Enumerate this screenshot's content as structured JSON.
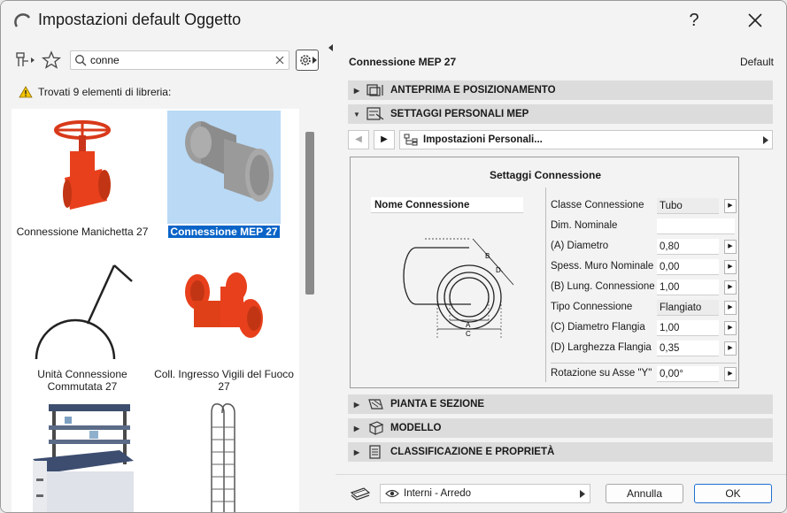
{
  "window": {
    "title": "Impostazioni default Oggetto",
    "help": "?"
  },
  "search": {
    "value": "conne"
  },
  "library": {
    "found_text": "Trovati 9 elementi di libreria:",
    "items": [
      {
        "label": "Connessione Manichetta 27",
        "selected": false
      },
      {
        "label": "Connessione MEP 27",
        "selected": true
      },
      {
        "label": "Unità Connessione Commutata 27",
        "selected": false
      },
      {
        "label": "Coll. Ingresso Vigili del Fuoco 27",
        "selected": false
      },
      {
        "label": "",
        "selected": false
      },
      {
        "label": "",
        "selected": false
      }
    ]
  },
  "header": {
    "object_name": "Connessione MEP 27",
    "default_label": "Default"
  },
  "sections": {
    "preview": "ANTEPRIMA E POSIZIONAMENTO",
    "custom": "SETTAGGI PERSONALI MEP",
    "plan": "PIANTA E SEZIONE",
    "model": "MODELLO",
    "classification": "CLASSIFICAZIONE E PROPRIETÀ"
  },
  "custom_panel": {
    "selector": "Impostazioni Personali...",
    "box_title": "Settaggi Connessione",
    "name_field": "Nome Connessione",
    "params": [
      {
        "label": "Classe Connessione",
        "value": "Tubo"
      },
      {
        "label": "Dim. Nominale",
        "value": ""
      },
      {
        "label": "(A) Diametro",
        "value": "0,80"
      },
      {
        "label": "Spess. Muro Nominale",
        "value": "0,00"
      },
      {
        "label": "(B) Lung. Connessione",
        "value": "1,00"
      },
      {
        "label": "Tipo Connessione",
        "value": "Flangiato"
      },
      {
        "label": "(C) Diametro Flangia",
        "value": "1,00"
      },
      {
        "label": "(D) Larghezza Flangia",
        "value": "0,35"
      },
      {
        "label": "Rotazione su Asse \"Y\"",
        "value": "0,00°"
      }
    ],
    "diagram_labels": {
      "a": "A",
      "b": "B",
      "c": "C",
      "d": "D"
    }
  },
  "footer": {
    "layer": "Interni - Arredo",
    "cancel": "Annulla",
    "ok": "OK"
  },
  "colors": {
    "accent": "#0a64c8",
    "object_red": "#e8401c",
    "selection_bg": "#b9d9f5"
  }
}
